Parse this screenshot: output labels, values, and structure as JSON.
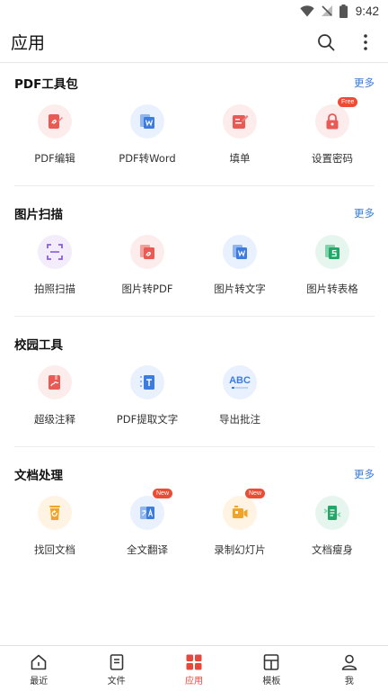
{
  "status_bar": {
    "time": "9:42"
  },
  "app_bar": {
    "title": "应用",
    "search_icon": "search-icon",
    "more_icon": "more-vertical-icon"
  },
  "sections": [
    {
      "title": "PDF工具包",
      "more": "更多",
      "items": [
        {
          "label": "PDF编辑",
          "icon": "pdf-edit-icon",
          "bg": "#fdecec",
          "color": "#ea5a55"
        },
        {
          "label": "PDF转Word",
          "icon": "pdf-to-word-icon",
          "bg": "#e8f1fd",
          "color": "#3c7be0"
        },
        {
          "label": "填单",
          "icon": "fill-form-icon",
          "bg": "#fdecec",
          "color": "#ea5a55"
        },
        {
          "label": "设置密码",
          "icon": "lock-icon",
          "bg": "#fdecec",
          "color": "#ea5a55",
          "badge": "Free"
        }
      ]
    },
    {
      "title": "图片扫描",
      "more": "更多",
      "items": [
        {
          "label": "拍照扫描",
          "icon": "scan-icon",
          "bg": "#f2ecfb",
          "color": "#8a5cdc"
        },
        {
          "label": "图片转PDF",
          "icon": "image-to-pdf-icon",
          "bg": "#fdecec",
          "color": "#ea5a55"
        },
        {
          "label": "图片转文字",
          "icon": "image-to-text-icon",
          "bg": "#e8f1fd",
          "color": "#3c7be0"
        },
        {
          "label": "图片转表格",
          "icon": "image-to-table-icon",
          "bg": "#e6f6ee",
          "color": "#23a769"
        }
      ]
    },
    {
      "title": "校园工具",
      "more": "",
      "items": [
        {
          "label": "超级注释",
          "icon": "annotate-icon",
          "bg": "#fdecec",
          "color": "#ea5a55"
        },
        {
          "label": "PDF提取文字",
          "icon": "extract-text-icon",
          "bg": "#e8f1fd",
          "color": "#3c7be0"
        },
        {
          "label": "导出批注",
          "icon": "export-abc-icon",
          "bg": "#e8f1fd",
          "color": "#3c7be0",
          "glyph": "ABC"
        }
      ]
    },
    {
      "title": "文档处理",
      "more": "更多",
      "items": [
        {
          "label": "找回文档",
          "icon": "recover-trash-icon",
          "bg": "#fff4e3",
          "color": "#f1a528"
        },
        {
          "label": "全文翻译",
          "icon": "translate-icon",
          "bg": "#e8f1fd",
          "color": "#3c7be0",
          "badge": "New"
        },
        {
          "label": "录制幻灯片",
          "icon": "record-slide-icon",
          "bg": "#fff4e3",
          "color": "#f1a528",
          "badge": "New"
        },
        {
          "label": "文档瘦身",
          "icon": "slim-doc-icon",
          "bg": "#e6f6ee",
          "color": "#23a769"
        }
      ]
    }
  ],
  "bottom_nav": [
    {
      "label": "最近",
      "icon": "home-icon",
      "active": false
    },
    {
      "label": "文件",
      "icon": "file-icon",
      "active": false
    },
    {
      "label": "应用",
      "icon": "apps-grid-icon",
      "active": true
    },
    {
      "label": "模板",
      "icon": "template-icon",
      "active": false
    },
    {
      "label": "我",
      "icon": "profile-icon",
      "active": false
    }
  ],
  "colors": {
    "accent": "#e8473b",
    "link": "#3a7bd5"
  }
}
